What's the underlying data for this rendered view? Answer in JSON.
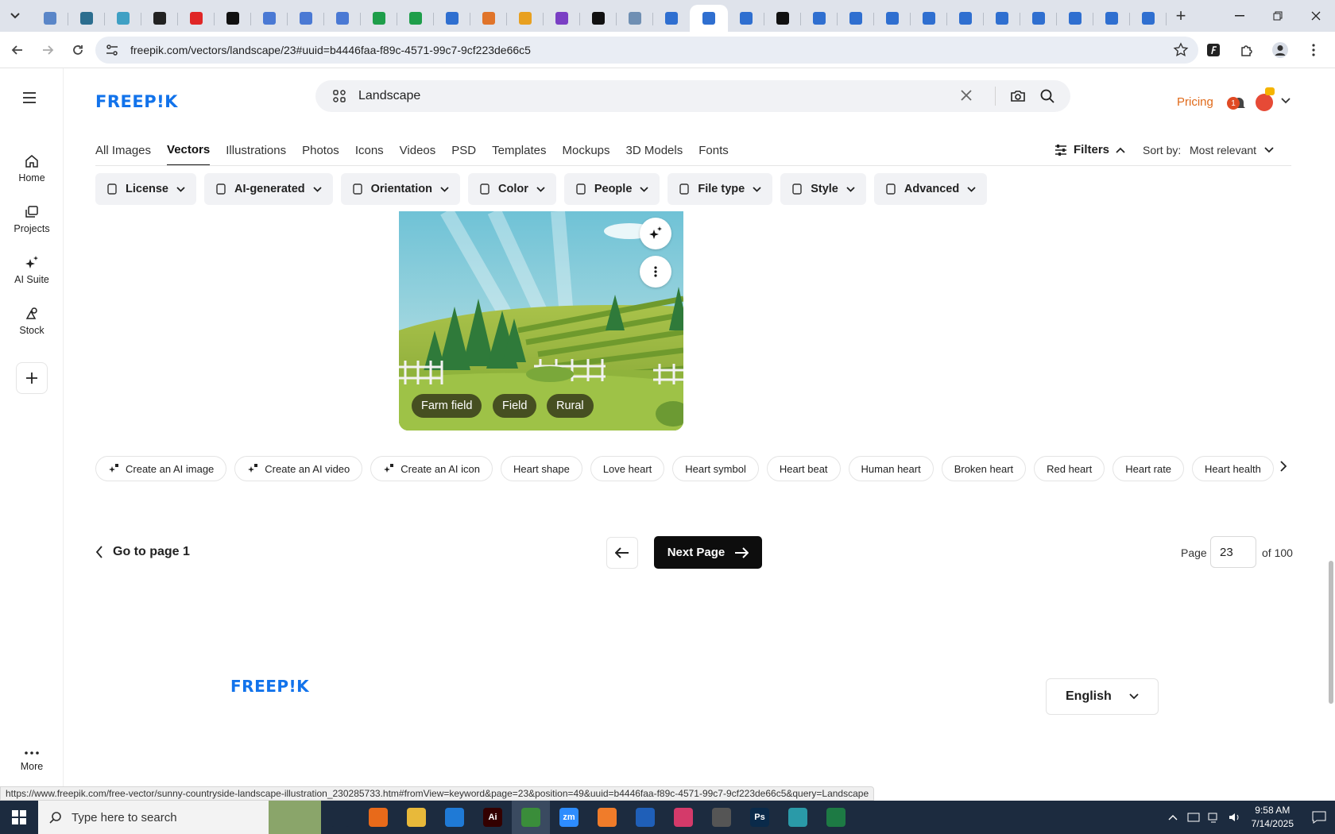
{
  "browser": {
    "url": "freepik.com/vectors/landscape/23#uuid=b4446faa-f89c-4571-99c7-9cf223de66c5",
    "status_url": "https://www.freepik.com/free-vector/sunny-countryside-landscape-illustration_230285733.htm#fromView=keyword&page=23&position=49&uuid=b4446faa-f89c-4571-99c7-9cf223de66c5&query=Landscape",
    "tab_count": 31
  },
  "nav": {
    "items": [
      {
        "label": "Home",
        "icon": "home-icon"
      },
      {
        "label": "Projects",
        "icon": "projects-icon"
      },
      {
        "label": "AI Suite",
        "icon": "sparkles-icon"
      },
      {
        "label": "Stock",
        "icon": "stock-icon"
      }
    ],
    "more_label": "More"
  },
  "header": {
    "logo": "FREEP!K",
    "search_value": "Landscape",
    "pricing_label": "Pricing",
    "notification_count": "1"
  },
  "type_tabs": [
    "All Images",
    "Vectors",
    "Illustrations",
    "Photos",
    "Icons",
    "Videos",
    "PSD",
    "Templates",
    "Mockups",
    "3D Models",
    "Fonts"
  ],
  "active_type_tab": "Vectors",
  "filters_label": "Filters",
  "sort": {
    "label": "Sort by:",
    "value": "Most relevant"
  },
  "filter_chips": [
    "License",
    "AI-generated",
    "Orientation",
    "Color",
    "People",
    "File type",
    "Style",
    "Advanced"
  ],
  "image_tags": [
    "Farm field",
    "Field",
    "Rural"
  ],
  "related": {
    "ai_chips": [
      "Create an AI image",
      "Create an AI video",
      "Create an AI icon"
    ],
    "chips": [
      "Heart shape",
      "Love heart",
      "Heart symbol",
      "Heart beat",
      "Human heart",
      "Broken heart",
      "Red heart",
      "Heart rate",
      "Heart health"
    ]
  },
  "pagination": {
    "goto_first": "Go to page 1",
    "next_label": "Next Page",
    "page_label": "Page",
    "current_page": "23",
    "of_label": "of 100"
  },
  "footer": {
    "logo": "FREEP!K",
    "language": "English"
  },
  "taskbar": {
    "search_placeholder": "Type here to search",
    "time": "9:58 AM",
    "date": "7/14/2025"
  },
  "colors": {
    "brand": "#1273eb",
    "pricing": "#e06a1a",
    "next_button": "#0d0d0d",
    "taskbar": "#1c2b3f"
  }
}
